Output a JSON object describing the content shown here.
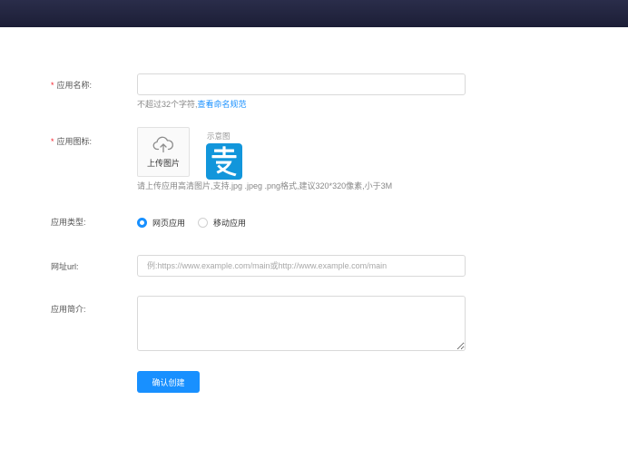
{
  "form": {
    "name": {
      "label": "应用名称:",
      "required_mark": "*",
      "value": "",
      "hint_text": "不超过32个字符,",
      "hint_link": "查看命名规范"
    },
    "icon": {
      "label": "应用图标:",
      "required_mark": "*",
      "upload_label": "上传图片",
      "upload_icon": "cloud-upload-icon",
      "example_label": "示意图",
      "example_icon": "alipay-logo",
      "hint_text": "请上传应用高清图片,支持.jpg .jpeg .png格式,建议320*320像素,小于3M"
    },
    "type": {
      "label": "应用类型:",
      "options": [
        {
          "label": "网页应用",
          "checked": true
        },
        {
          "label": "移动应用",
          "checked": false
        }
      ]
    },
    "url": {
      "label": "网址url:",
      "value": "",
      "placeholder": "例:https://www.example.com/main或http://www.example.com/main"
    },
    "intro": {
      "label": "应用简介:",
      "value": ""
    },
    "submit_label": "确认创建"
  },
  "colors": {
    "accent": "#1890ff",
    "required": "#f5222d",
    "topbar": "#1c1e36",
    "example_bg": "#1296db"
  }
}
